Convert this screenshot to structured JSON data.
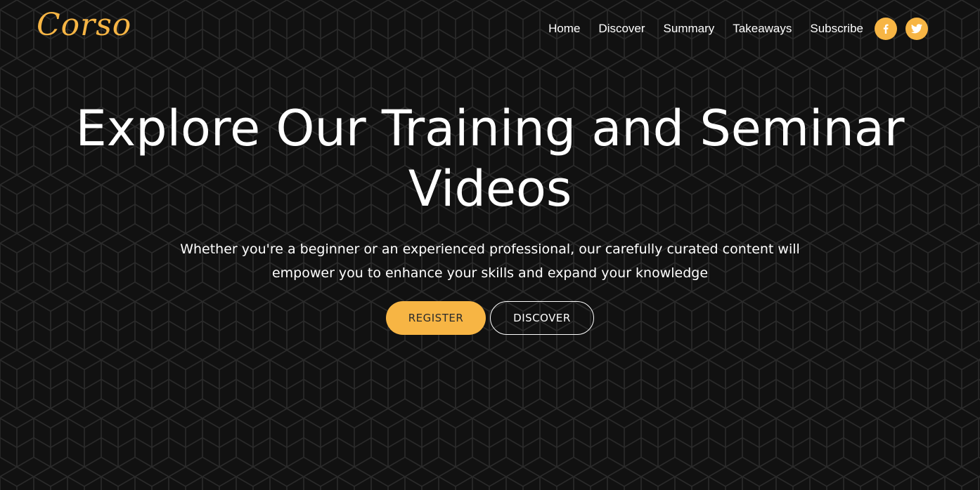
{
  "brand": {
    "logo_text": "Corso"
  },
  "nav": {
    "items": [
      {
        "label": "Home"
      },
      {
        "label": "Discover"
      },
      {
        "label": "Summary"
      },
      {
        "label": "Takeaways"
      },
      {
        "label": "Subscribe"
      }
    ],
    "social": [
      {
        "icon": "facebook-icon"
      },
      {
        "icon": "twitter-icon"
      }
    ]
  },
  "hero": {
    "title": "Explore Our Training and Seminar Videos",
    "description": "Whether you're a beginner or an experienced professional, our carefully curated content will empower you to enhance your skills and expand your knowledge",
    "register_label": "REGISTER",
    "discover_label": "DISCOVER"
  },
  "colors": {
    "accent": "#f7b544",
    "background": "#111111",
    "pattern_line": "#2b2b2b",
    "text": "#ffffff"
  }
}
